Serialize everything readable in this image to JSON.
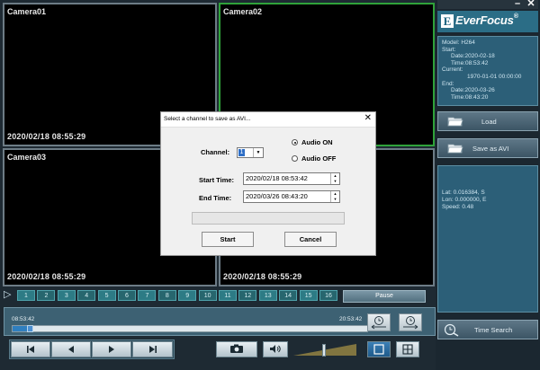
{
  "cameras": [
    {
      "label": "Camera01",
      "timestamp": "2020/02/18  08:55:29"
    },
    {
      "label": "Camera02",
      "timestamp": ""
    },
    {
      "label": "Camera03",
      "timestamp": "2020/02/18  08:55:29"
    },
    {
      "label": "",
      "timestamp": "2020/02/18  08:55:29"
    }
  ],
  "window": {
    "minimize": "–",
    "close": "✕"
  },
  "logo": {
    "mark": "E",
    "text": "EverFocus",
    "reg": "®"
  },
  "info": {
    "model": "Model: H264",
    "start_label": "Start:",
    "start_date": "Date:2020-02-18",
    "start_time": "Time:08:53:42",
    "current_label": "Current:",
    "current_value": "1970-01-01 00:00:00",
    "end_label": "End:",
    "end_date": "Date:2020-03-26",
    "end_time": "Time:08:43:20"
  },
  "buttons": {
    "load": "Load",
    "save_avi": "Save as AVI",
    "time_search": "Time Search",
    "pause": "Pause"
  },
  "gps": {
    "lat": "Lat: 0.016384, S",
    "lon": "Lon: 0.000000, E",
    "speed": "Speed: 0.48"
  },
  "channels": [
    "1",
    "2",
    "3",
    "4",
    "5",
    "6",
    "7",
    "8",
    "9",
    "10",
    "11",
    "12",
    "13",
    "14",
    "15",
    "16"
  ],
  "timeline": {
    "start": "08:53:42",
    "end": "20:53:42",
    "position": 0.04
  },
  "volume": {
    "level": 0.45
  },
  "dialog": {
    "title": "Select a channel to save as AVI...",
    "close": "✕",
    "channel_label": "Channel:",
    "channel_value": "1",
    "audio_on": "Audio ON",
    "audio_off": "Audio OFF",
    "start_time_label": "Start Time:",
    "start_time_value": "2020/02/18 08:53:42",
    "end_time_label": "End Time:",
    "end_time_value": "2020/03/26 08:43:20",
    "start_button": "Start",
    "cancel_button": "Cancel"
  },
  "colors": {
    "active_camera_border": "#2fa23a",
    "panel": "#2c5f78",
    "channel": "#2d7b85",
    "accent": "#2f7fbf"
  }
}
